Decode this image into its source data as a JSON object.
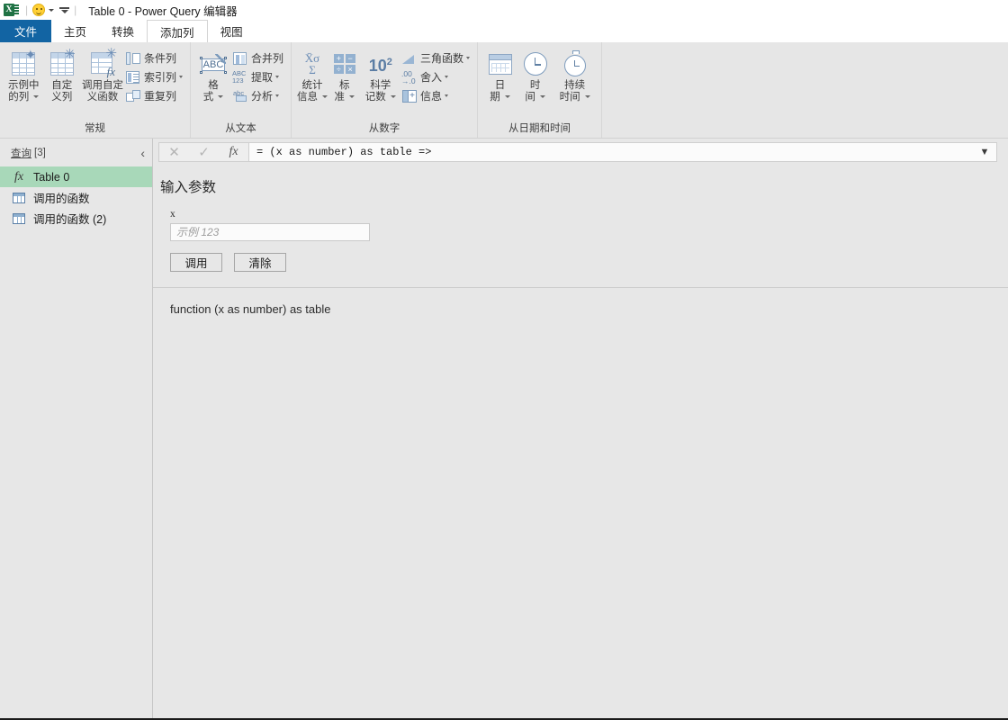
{
  "titlebar": {
    "app_icon": "excel-icon",
    "quick_access": [
      {
        "icon": "smiley-feedback-icon",
        "name": "feedback"
      },
      {
        "icon": "chevron-down-icon",
        "name": "quick-access-dropdown"
      },
      {
        "icon": "customize-toolbar-icon",
        "name": "customize-quick-access"
      }
    ],
    "title": "Table 0 - Power Query 编辑器"
  },
  "tabs": [
    {
      "label": "文件",
      "state": "file"
    },
    {
      "label": "主页",
      "state": "normal"
    },
    {
      "label": "转换",
      "state": "normal"
    },
    {
      "label": "添加列",
      "state": "active"
    },
    {
      "label": "视图",
      "state": "normal"
    }
  ],
  "ribbon": {
    "groups": [
      {
        "title": "常规",
        "big_buttons": [
          {
            "label_line1": "示例中",
            "label_line2": "的列",
            "icon": "table-sparkle-icon",
            "has_caret": true
          },
          {
            "label_line1": "自定",
            "label_line2": "义列",
            "icon": "table-custom-icon",
            "has_caret": false
          },
          {
            "label_line1": "调用自定",
            "label_line2": "义函数",
            "icon": "table-function-icon",
            "has_caret": false
          }
        ],
        "small_buttons": [
          {
            "label": "条件列",
            "icon": "conditional-column-icon",
            "has_caret": false
          },
          {
            "label": "索引列",
            "icon": "index-column-icon",
            "has_caret": true
          },
          {
            "label": "重复列",
            "icon": "duplicate-column-icon",
            "has_caret": false
          }
        ]
      },
      {
        "title": "从文本",
        "big_buttons": [
          {
            "label_line1": "格",
            "label_line2": "式",
            "icon": "format-abc-icon",
            "has_caret": true
          }
        ],
        "small_buttons": [
          {
            "label": "合并列",
            "icon": "merge-columns-icon",
            "has_caret": false
          },
          {
            "label": "提取",
            "icon": "extract-abc123-icon",
            "has_caret": true
          },
          {
            "label": "分析",
            "icon": "parse-abc-icon",
            "has_caret": true
          }
        ]
      },
      {
        "title": "从数字",
        "big_buttons": [
          {
            "label_line1": "统计",
            "label_line2": "信息",
            "icon": "statistics-sigma-icon",
            "has_caret": true
          },
          {
            "label_line1": "标",
            "label_line2": "准",
            "icon": "standard-math-icon",
            "has_caret": true
          },
          {
            "label_line1": "科学",
            "label_line2": "记数",
            "icon": "scientific-notation-icon",
            "has_caret": true
          }
        ],
        "small_buttons": [
          {
            "label": "三角函数",
            "icon": "trigonometry-icon",
            "has_caret": true
          },
          {
            "label": "舍入",
            "icon": "rounding-icon",
            "has_caret": true
          },
          {
            "label": "信息",
            "icon": "number-info-icon",
            "has_caret": true
          }
        ]
      },
      {
        "title": "从日期和时间",
        "big_buttons": [
          {
            "label_line1": "日",
            "label_line2": "期",
            "icon": "calendar-icon",
            "has_caret": true
          },
          {
            "label_line1": "时",
            "label_line2": "间",
            "icon": "clock-icon",
            "has_caret": true
          },
          {
            "label_line1": "持续",
            "label_line2": "时间",
            "icon": "stopwatch-icon",
            "has_caret": true
          }
        ],
        "small_buttons": []
      }
    ]
  },
  "queries_pane": {
    "header_label": "查询",
    "header_count": "[3]",
    "collapse_icon": "chevron-left-icon",
    "items": [
      {
        "label": "Table 0",
        "icon": "fx-function-icon",
        "selected": true
      },
      {
        "label": "调用的函数",
        "icon": "table-icon",
        "selected": false
      },
      {
        "label": "调用的函数 (2)",
        "icon": "table-icon",
        "selected": false
      }
    ]
  },
  "formula_bar": {
    "cancel_icon": "close-icon",
    "accept_icon": "check-icon",
    "fx_icon": "fx-icon",
    "value": "= (x as number) as table =>",
    "expand_icon": "chevron-down-icon"
  },
  "content": {
    "invoke_title": "输入参数",
    "parameter_label": "x",
    "parameter_value": "",
    "parameter_placeholder": "示例 123",
    "invoke_button": "调用",
    "clear_button": "清除",
    "function_signature": "function (x as number) as table"
  },
  "colors": {
    "accent_file_tab": "#1264a3",
    "selection_green": "#a8d8b9",
    "ribbon_bg": "#e6e6e6",
    "canvas_bg": "#e7e7e7",
    "icon_blue": "#7e9cbd"
  }
}
